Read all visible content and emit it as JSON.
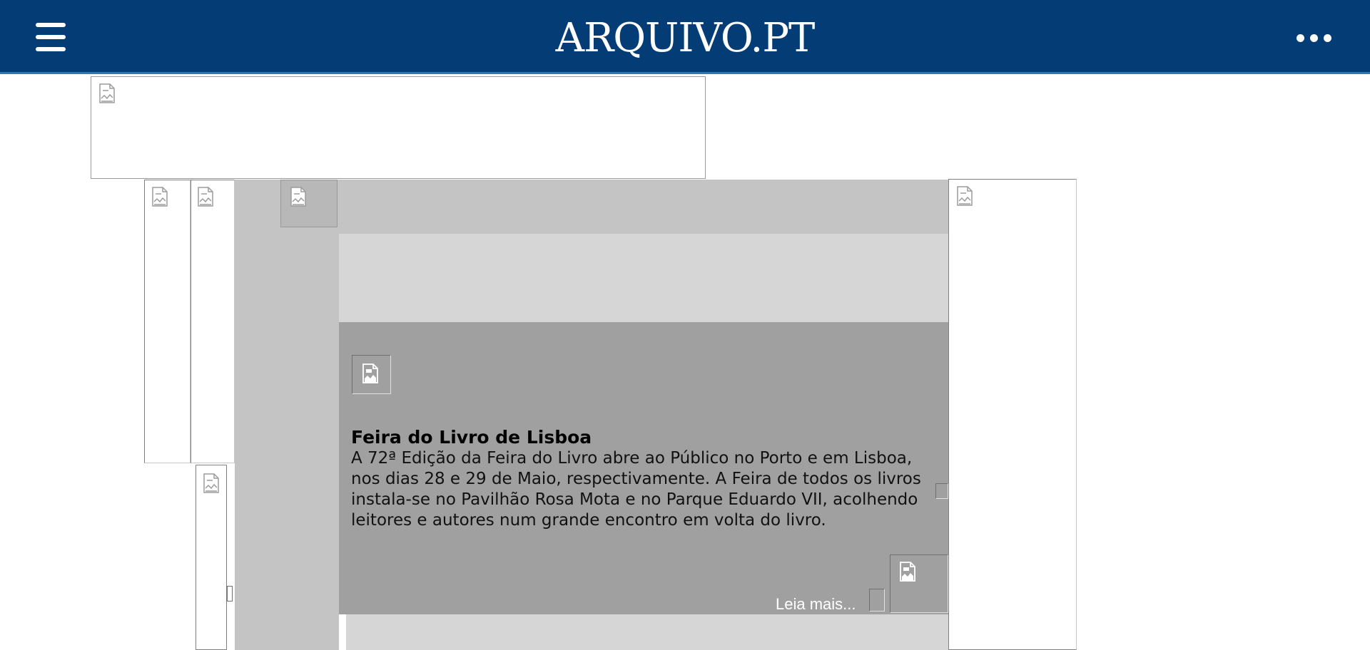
{
  "header": {
    "logo": "ARQUIVO.PT",
    "menu_icon": "hamburger-menu-icon",
    "more_icon": "more-options-icon",
    "background": "#043d75"
  },
  "article": {
    "title": "Feira do Livro de Lisboa",
    "body": "A 72ª Edição da Feira do Livro abre ao Público no Porto e em Lisboa, nos dias 28 e 29 de Maio, respectivamente. A Feira de todos os livros instala-se no Pavilhão Rosa Mota e no Parque Eduardo VII, acolhendo leitores e autores num grande encontro em volta do livro.",
    "read_more": "Leia mais..."
  },
  "placeholder_icon": "broken-image-icon"
}
